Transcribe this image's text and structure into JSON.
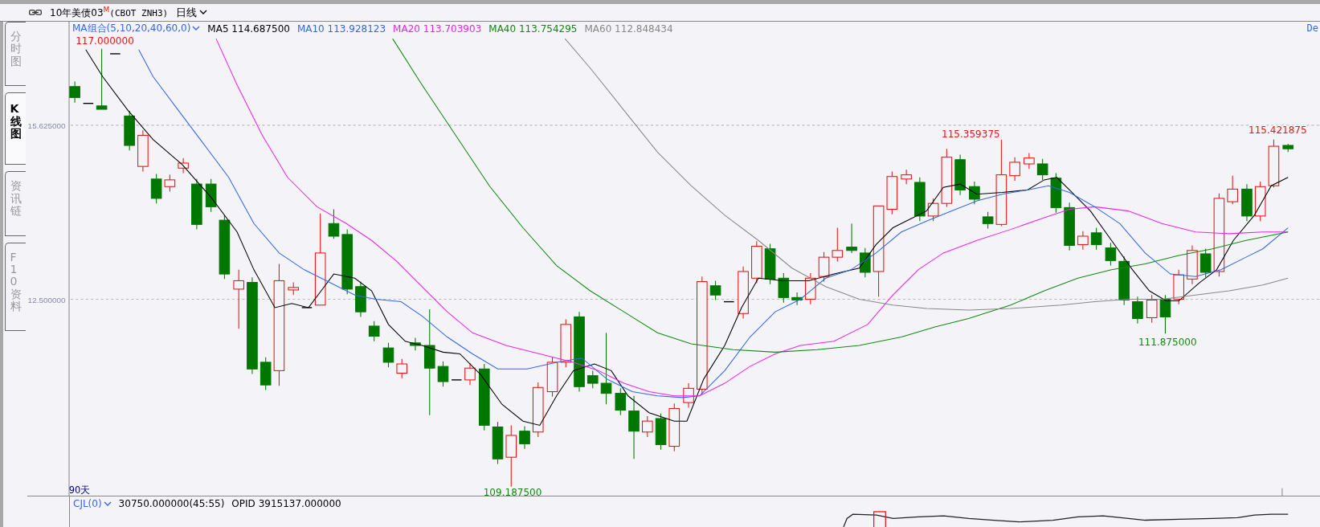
{
  "title_bar": {
    "symbol": "10年美债03",
    "badge": "M",
    "code": "(CBOT ZNH3)",
    "period": "日线"
  },
  "side_tabs": [
    {
      "label": "分时图",
      "selected": false
    },
    {
      "label": "K线图",
      "selected": true
    },
    {
      "label": "资讯链",
      "selected": false
    },
    {
      "label": "F10资料",
      "selected": false
    }
  ],
  "main_chart": {
    "indicator": "MA组合(5,10,20,40,60,0)",
    "ma_values": [
      {
        "label": "MA5 114.687500",
        "color": "#000000"
      },
      {
        "label": "MA10 113.928123",
        "color": "#3366ee"
      },
      {
        "label": "MA20 113.703903",
        "color": "#ee22ee"
      },
      {
        "label": "MA40 113.754295",
        "color": "#118811"
      },
      {
        "label": "MA60 112.848434",
        "color": "#888888"
      }
    ],
    "corner_text": "De",
    "axis_labels": [
      "15.625000",
      "12.500000"
    ],
    "price_labels": [
      {
        "text": "117.000000",
        "kind": "high"
      },
      {
        "text": "115.359375",
        "kind": "high"
      },
      {
        "text": "115.421875",
        "kind": "high"
      },
      {
        "text": "111.875000",
        "kind": "low"
      },
      {
        "text": "109.187500",
        "kind": "low"
      }
    ],
    "range_label": "90天"
  },
  "volume_pane": {
    "indicator": "CJL(0)",
    "values": [
      "30750.000000(45:55)",
      "OPID 3915137.000000"
    ]
  }
}
